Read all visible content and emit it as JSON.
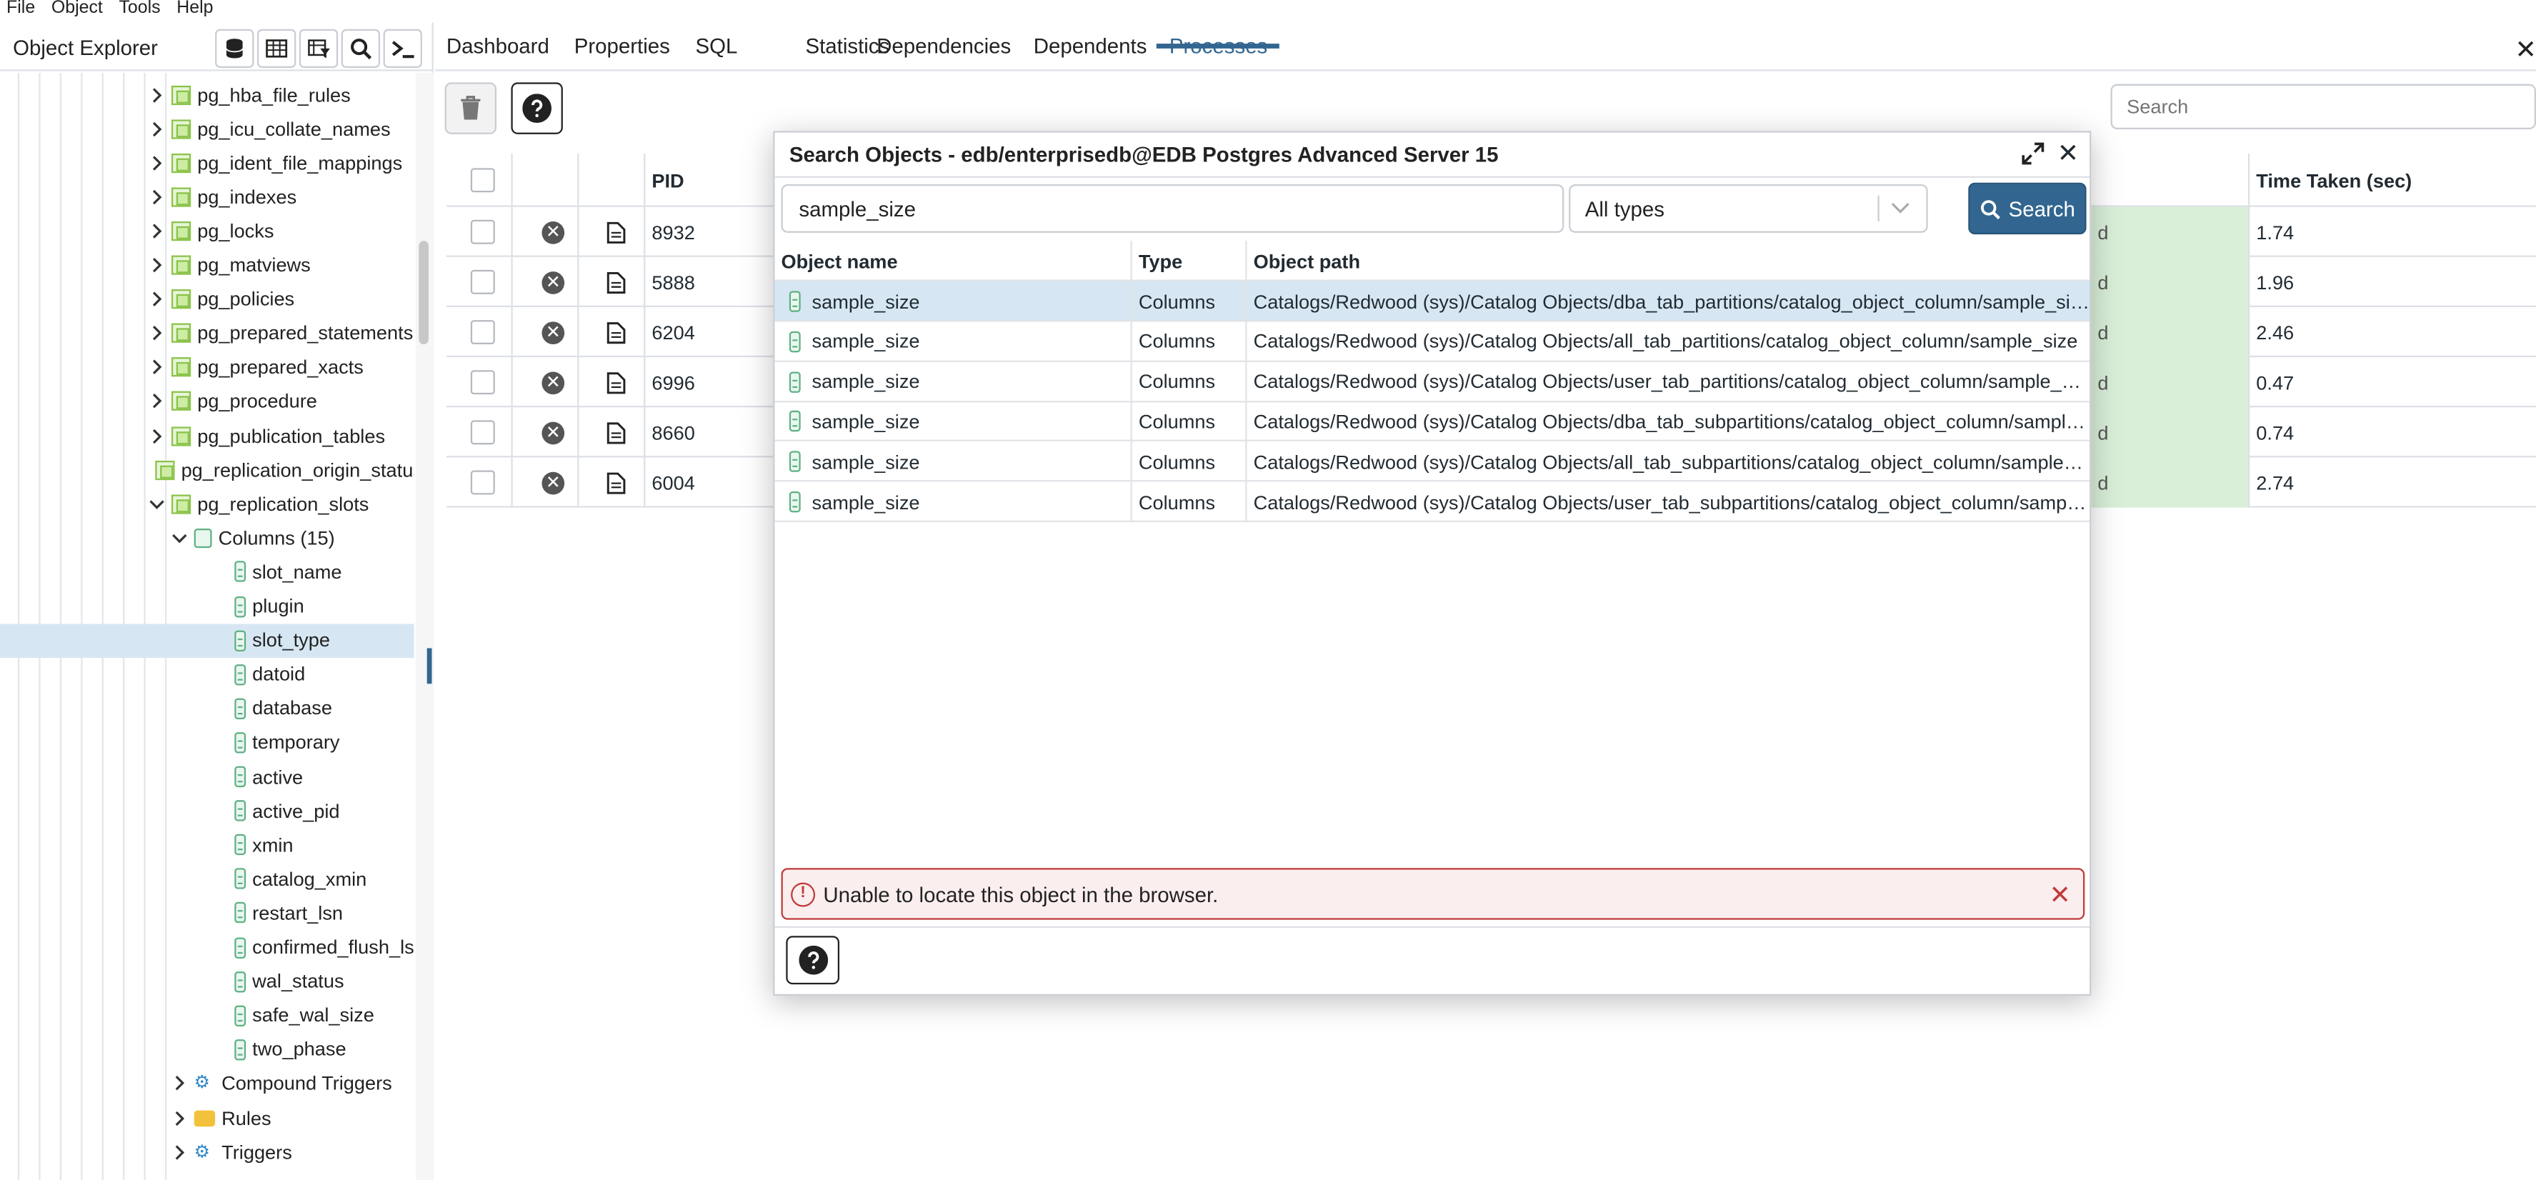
{
  "menubar": [
    "File",
    "Object",
    "Tools",
    "Help"
  ],
  "object_explorer": {
    "title": "Object Explorer",
    "toolbar_icons": [
      "database-icon",
      "table-grid-icon",
      "filter-table-icon",
      "search-icon",
      "terminal-icon"
    ],
    "tree": [
      {
        "label": "pg_hba_file_rules",
        "kind": "view",
        "level": 1,
        "expanded": false
      },
      {
        "label": "pg_icu_collate_names",
        "kind": "view",
        "level": 1,
        "expanded": false
      },
      {
        "label": "pg_ident_file_mappings",
        "kind": "view",
        "level": 1,
        "expanded": false
      },
      {
        "label": "pg_indexes",
        "kind": "view",
        "level": 1,
        "expanded": false
      },
      {
        "label": "pg_locks",
        "kind": "view",
        "level": 1,
        "expanded": false
      },
      {
        "label": "pg_matviews",
        "kind": "view",
        "level": 1,
        "expanded": false
      },
      {
        "label": "pg_policies",
        "kind": "view",
        "level": 1,
        "expanded": false
      },
      {
        "label": "pg_prepared_statements",
        "kind": "view",
        "level": 1,
        "expanded": false
      },
      {
        "label": "pg_prepared_xacts",
        "kind": "view",
        "level": 1,
        "expanded": false
      },
      {
        "label": "pg_procedure",
        "kind": "view",
        "level": 1,
        "expanded": false
      },
      {
        "label": "pg_publication_tables",
        "kind": "view",
        "level": 1,
        "expanded": false
      },
      {
        "label": "pg_replication_origin_status",
        "kind": "view",
        "level": 1,
        "expanded": false
      },
      {
        "label": "pg_replication_slots",
        "kind": "view",
        "level": 1,
        "expanded": true
      },
      {
        "label": "Columns (15)",
        "kind": "columns",
        "level": 2,
        "expanded": true
      },
      {
        "label": "slot_name",
        "kind": "column",
        "level": 3
      },
      {
        "label": "plugin",
        "kind": "column",
        "level": 3
      },
      {
        "label": "slot_type",
        "kind": "column",
        "level": 3,
        "selected": true
      },
      {
        "label": "datoid",
        "kind": "column",
        "level": 3
      },
      {
        "label": "database",
        "kind": "column",
        "level": 3
      },
      {
        "label": "temporary",
        "kind": "column",
        "level": 3
      },
      {
        "label": "active",
        "kind": "column",
        "level": 3
      },
      {
        "label": "active_pid",
        "kind": "column",
        "level": 3
      },
      {
        "label": "xmin",
        "kind": "column",
        "level": 3
      },
      {
        "label": "catalog_xmin",
        "kind": "column",
        "level": 3
      },
      {
        "label": "restart_lsn",
        "kind": "column",
        "level": 3
      },
      {
        "label": "confirmed_flush_lsn",
        "kind": "column",
        "level": 3
      },
      {
        "label": "wal_status",
        "kind": "column",
        "level": 3
      },
      {
        "label": "safe_wal_size",
        "kind": "column",
        "level": 3
      },
      {
        "label": "two_phase",
        "kind": "column",
        "level": 3
      },
      {
        "label": "Compound Triggers",
        "kind": "trigger",
        "level": 2,
        "expanded": false
      },
      {
        "label": "Rules",
        "kind": "rules",
        "level": 2,
        "expanded": false
      },
      {
        "label": "Triggers",
        "kind": "trigger",
        "level": 2,
        "expanded": false
      }
    ]
  },
  "tabs": [
    "Dashboard",
    "Properties",
    "SQL",
    "Statistics",
    "Dependencies",
    "Dependents",
    "Processes"
  ],
  "active_tab": "Processes",
  "processes": {
    "search_placeholder": "Search",
    "columns": {
      "pid": "PID",
      "time_taken": "Time Taken (sec)"
    },
    "rows": [
      {
        "pid": "8932",
        "state": "d",
        "time": "1.74"
      },
      {
        "pid": "5888",
        "state": "d",
        "time": "1.96"
      },
      {
        "pid": "6204",
        "state": "d",
        "time": "2.46"
      },
      {
        "pid": "6996",
        "state": "d",
        "time": "0.47"
      },
      {
        "pid": "8660",
        "state": "d",
        "time": "0.74"
      },
      {
        "pid": "6004",
        "state": "d",
        "time": "2.74"
      }
    ]
  },
  "dialog": {
    "title": "Search Objects - edb/enterprisedb@EDB Postgres Advanced Server 15",
    "search_value": "sample_size",
    "type_filter": "All types",
    "search_button": "Search",
    "headers": {
      "name": "Object name",
      "type": "Type",
      "path": "Object path"
    },
    "results": [
      {
        "name": "sample_size",
        "type": "Columns",
        "path": "Catalogs/Redwood (sys)/Catalog Objects/dba_tab_partitions/catalog_object_column/sample_size"
      },
      {
        "name": "sample_size",
        "type": "Columns",
        "path": "Catalogs/Redwood (sys)/Catalog Objects/all_tab_partitions/catalog_object_column/sample_size"
      },
      {
        "name": "sample_size",
        "type": "Columns",
        "path": "Catalogs/Redwood (sys)/Catalog Objects/user_tab_partitions/catalog_object_column/sample_size"
      },
      {
        "name": "sample_size",
        "type": "Columns",
        "path": "Catalogs/Redwood (sys)/Catalog Objects/dba_tab_subpartitions/catalog_object_column/sample_size"
      },
      {
        "name": "sample_size",
        "type": "Columns",
        "path": "Catalogs/Redwood (sys)/Catalog Objects/all_tab_subpartitions/catalog_object_column/sample_size"
      },
      {
        "name": "sample_size",
        "type": "Columns",
        "path": "Catalogs/Redwood (sys)/Catalog Objects/user_tab_subpartitions/catalog_object_column/sample_size"
      }
    ],
    "error": "Unable to locate this object in the browser."
  },
  "colors": {
    "accent": "#326690",
    "selection": "#d6e7f3",
    "error_border": "#c13a3a",
    "error_bg": "#fbeeee",
    "state_cell": "#d9efd8"
  }
}
